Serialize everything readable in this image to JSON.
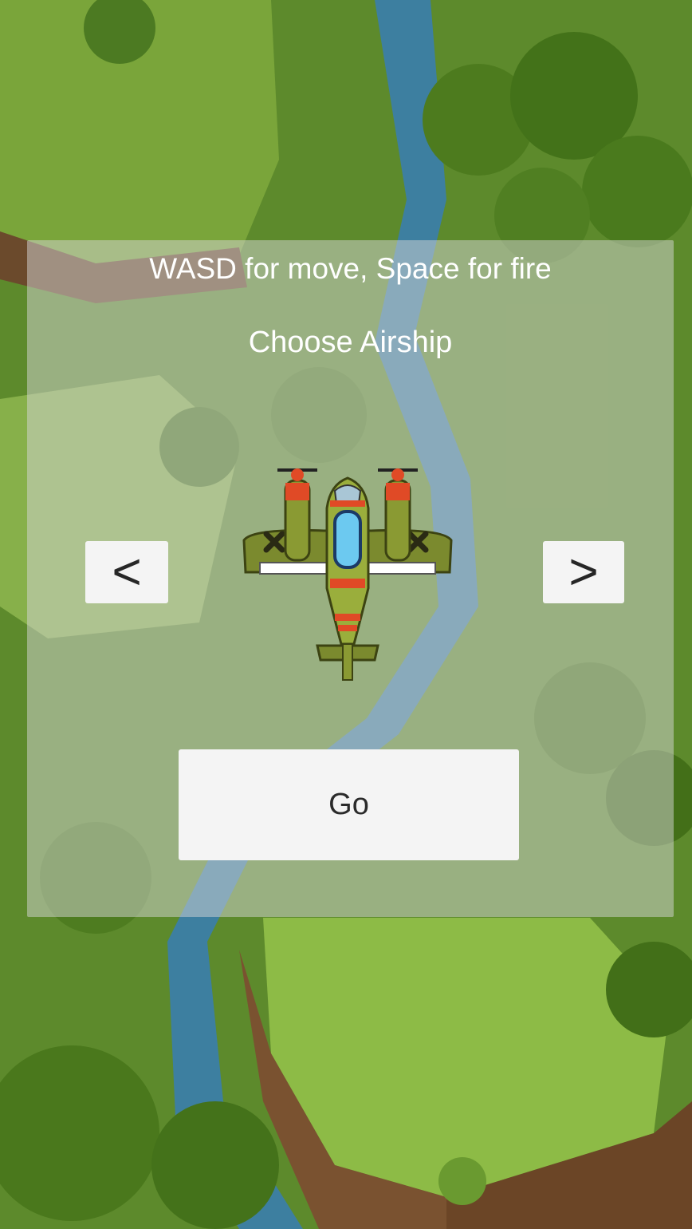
{
  "instructions": "WASD for move, Space for fire",
  "select_title": "Choose Airship",
  "prev_label": "<",
  "next_label": ">",
  "go_label": "Go",
  "airship_icon": "green-propeller-airship-icon",
  "colors": {
    "panel": "#d6d6d680",
    "button": "#f4f4f4",
    "button_text": "#262626",
    "title_text": "#ffffff"
  }
}
